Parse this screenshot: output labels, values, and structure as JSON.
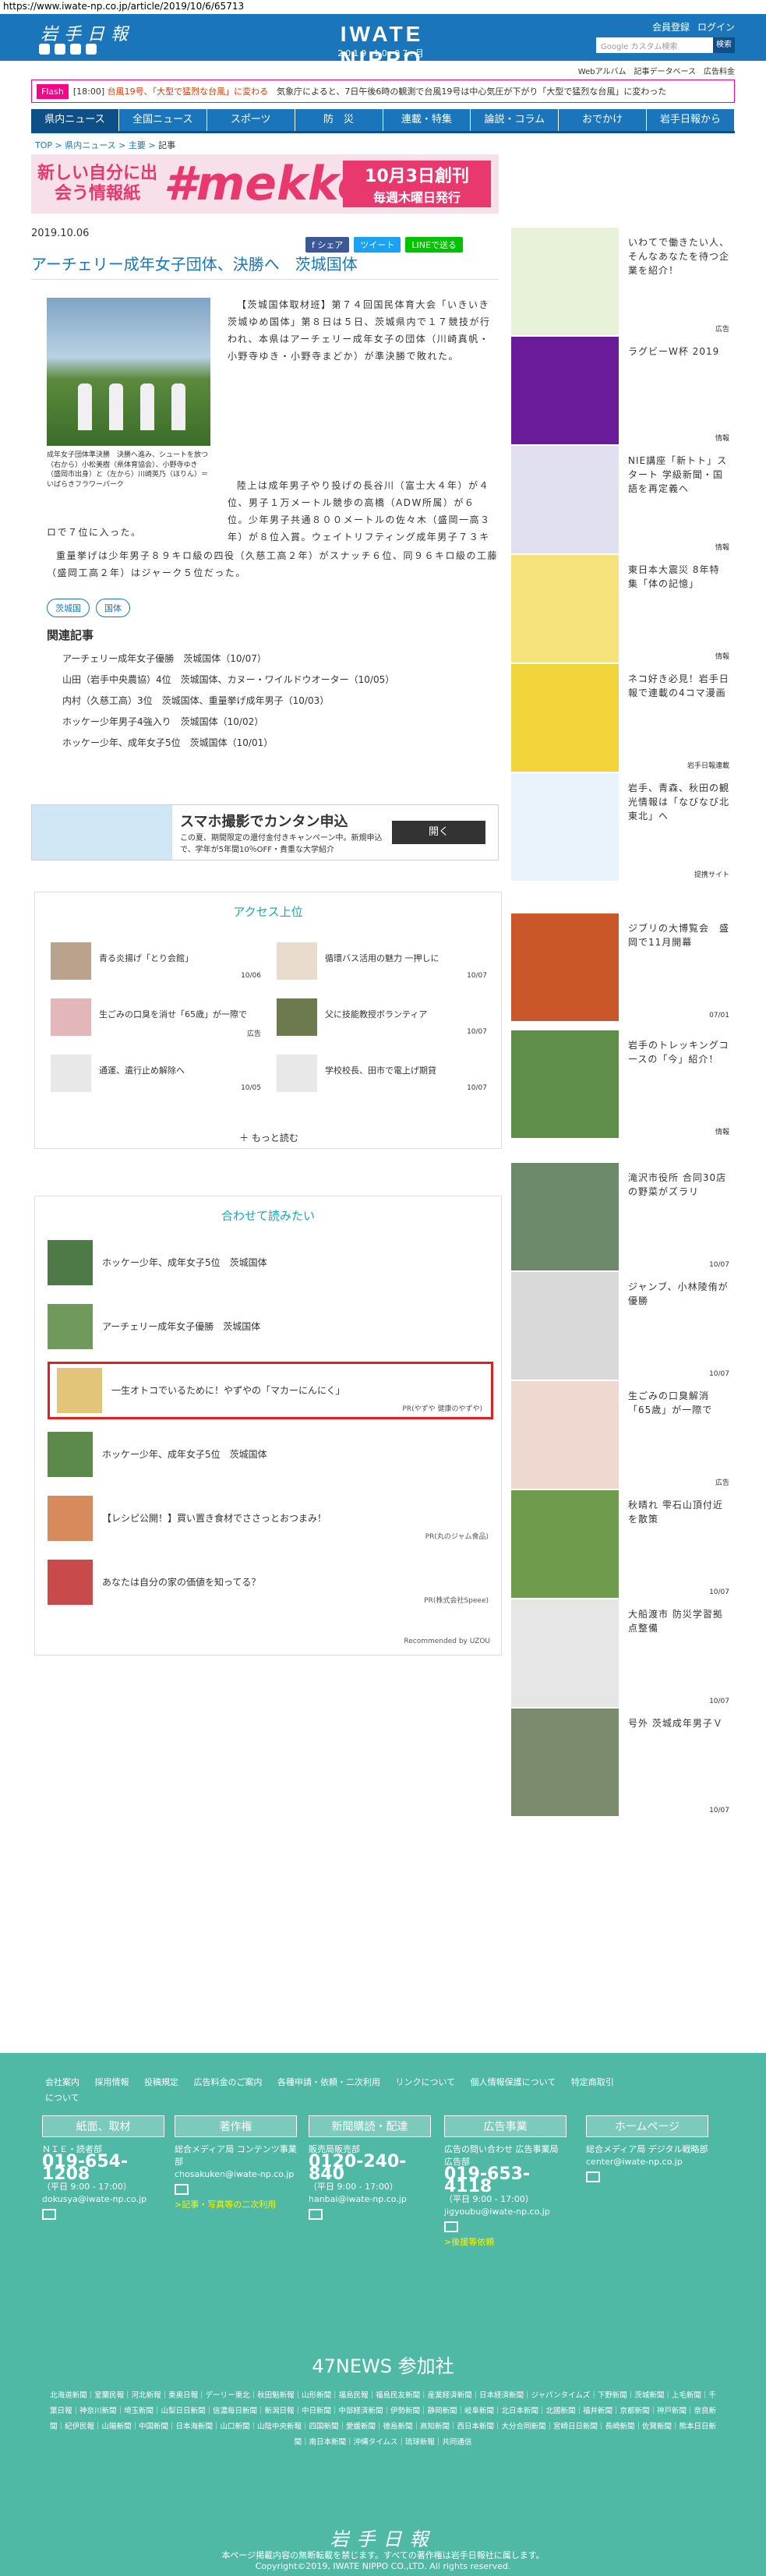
{
  "url": "https://www.iwate-np.co.jp/article/2019/10/6/65713",
  "header": {
    "logo_left": "岩手日報",
    "logo_center": "IWATE NIPPO",
    "date": "2019.10.07.月",
    "links": [
      "会員登録",
      "ログイン"
    ],
    "search_placeholder": "Google カスタム検索",
    "search_button": "検索",
    "sublinks": [
      "Webアルバム",
      "記事データベース",
      "広告料金"
    ]
  },
  "flash": {
    "tag": "Flash",
    "prefix": "[18:00]",
    "headline": "台風19号、「大型で猛烈な台風」に変わる",
    "rest": "気象庁によると、7日午後6時の観測で台風19号は中心気圧が下がり「大型で猛烈な台風」に変わった"
  },
  "nav": [
    "県内ニュース",
    "全国ニュース",
    "スポーツ",
    "防　災",
    "連載・特集",
    "論説・コラム",
    "おでかけ",
    "岩手日報から"
  ],
  "breadcrumb": [
    "TOP",
    "県内ニュース",
    "主要",
    "記事"
  ],
  "banner": {
    "left": "新しい自分に出会う情報紙",
    "center": "#mekke",
    "right_top": "10月3日創刊",
    "right_bottom": "毎週木曜日発行"
  },
  "article": {
    "date": "2019.10.06",
    "share": [
      "f シェア",
      "ツイート",
      "LINEで送る"
    ],
    "share_colors": [
      "#3b5998",
      "#1da1f2",
      "#00c300"
    ],
    "title": "アーチェリー成年女子団体、決勝へ　茨城国体",
    "caption": "成年女子団体準決勝　決勝へ進み、シュートを放つ（右から）小松美樹（県体育協会）、小野寺ゆき（盛岡市出身）と（左から）川崎英乃（ほりん）＝いばらきフラワーパーク",
    "p1": "【茨城国体取材班】第７４回国民体育大会「いきいき茨城ゆめ国体」第８日は５日、茨城県内で１７競技が行われ、本県はアーチェリー成年女子の団体（川崎真帆・小野寺ゆき・小野寺まどか）が準決勝で敗れた。",
    "p2": "陸上は成年男子やり投げの長谷川（富士大４年）が４位、男子１万メートル競歩の高橋（ADW所属）が６位。少年男子共通８００メートルの佐々木（盛岡一高３年）が８位入賞。ウェイトリフティング成年男子７３キ",
    "p3": "ロで７位に入った。",
    "p4": "重量挙げは少年男子８９キロ級の四役（久慈工高２年）がスナッチ６位、同９６キロ級の工藤（盛岡工高２年）はジャーク５位だった。",
    "tags": [
      "茨城国",
      "国体"
    ],
    "related_heading": "関連記事",
    "related": [
      "アーチェリー成年女子優勝　茨城国体（10/07）",
      "山田（岩手中央農協）4位　茨城国体、カヌー・ワイルドウオーター（10/05）",
      "内村（久慈工高）3位　茨城国体、重量挙げ成年男子（10/03）",
      "ホッケー少年男子4強入り　茨城国体（10/02）",
      "ホッケー少年、成年女子5位　茨城国体（10/01）"
    ]
  },
  "ad": {
    "title": "スマホ撮影でカンタン申込",
    "sub": "この夏、期間限定の還付金付きキャンペーン中。新規申込で、学年が5年間10％OFF・貴重な大学紹介",
    "button": "開く"
  },
  "access": {
    "heading": "アクセス上位",
    "items": [
      {
        "title": "青る炎揚げ「とり会館」",
        "date": "10/06"
      },
      {
        "title": "循環バス活用の魅力 一押しに",
        "date": "10/07"
      },
      {
        "title": "生ごみの口臭を消せ「65歳」が一際で",
        "date": "広告"
      },
      {
        "title": "父に技能教授ボランティア",
        "date": "10/07"
      },
      {
        "title": "通運、遺行止め解除へ",
        "date": "10/05"
      },
      {
        "title": "学校校長、田市で電上げ期貸",
        "date": "10/07"
      }
    ],
    "more": "もっと読む"
  },
  "together": {
    "heading": "合わせて読みたい",
    "items": [
      {
        "title": "ホッケー少年、成年女子5位　茨城国体",
        "pr": ""
      },
      {
        "title": "アーチェリー成年女子優勝　茨城国体",
        "pr": ""
      },
      {
        "title": "一生オトコでいるために！やずやの「マカーにんにく」",
        "pr": "PR(やずや 健康のやずや)"
      },
      {
        "title": "ホッケー少年、成年女子5位　茨城国体",
        "pr": ""
      },
      {
        "title": "【レシピ公開！】買い置き食材でささっとおつまみ！",
        "pr": "PR(丸のジャム食品)"
      },
      {
        "title": "あなたは自分の家の価値を知ってる？",
        "pr": "PR(株式会社Speee)"
      }
    ],
    "recommended": "Recommended by UZOU"
  },
  "sidebar": [
    {
      "title": "いわてで働きたい人、そんなあなたを待つ企業を紹介！",
      "label": "広告",
      "color": "#e8f2d8"
    },
    {
      "title": "ラグビーW杯 2019",
      "label": "情報",
      "color": "#6a1b9a"
    },
    {
      "title": "NIE講座「新トト」スタート 学級新聞・国語を再定義へ",
      "label": "情報",
      "color": "#e0e0f0"
    },
    {
      "title": "東日本大震災 8年特集「体の記憶」",
      "label": "情報",
      "color": "#f6e27a"
    },
    {
      "title": "ネコ好き必見！岩手日報で連載の4コマ漫画",
      "label": "岩手日報連載",
      "color": "#f2d43b"
    },
    {
      "title": "岩手、青森、秋田の観光情報は「なびなび北東北」へ",
      "label": "提携サイト",
      "color": "#e9f3fb"
    },
    {
      "title": "ジブリの大博覧会　盛岡で11月開幕",
      "label": "07/01",
      "color": "#c9572a"
    },
    {
      "title": "岩手のトレッキングコースの「今」紹介！",
      "label": "情報",
      "color": "#5f8e4a"
    },
    {
      "title": "滝沢市役所 合同30店の野菜がズラリ",
      "label": "10/07",
      "color": "#6d8a6a"
    },
    {
      "title": "ジャンブ、小林陵侑が優勝",
      "label": "10/07",
      "color": "#d9d9d9"
    },
    {
      "title": "生ごみの口臭解消「65歳」が一際で",
      "label": "広告",
      "color": "#eed8d0"
    },
    {
      "title": "秋晴れ 雫石山頂付近を散策",
      "label": "10/07",
      "color": "#6f9c4c"
    },
    {
      "title": "大船渡市 防災学習拠点整備",
      "label": "10/07",
      "color": "#e6e6e6"
    },
    {
      "title": "号外 茨城成年男子Ｖ",
      "label": "10/07",
      "color": "#7a8b6e"
    }
  ],
  "footer": {
    "links": [
      "会社案内",
      "採用情報",
      "投稿規定",
      "広告料金のご案内",
      "各種申請・依頼・二次利用",
      "リンクについて",
      "個人情報保護について",
      "特定商取引について"
    ],
    "cols": [
      {
        "head": "紙面、取材",
        "sub": "ＮＩＥ・読者部",
        "tel": "019-654-1208",
        "hours": "（平日 9:00 - 17:00）",
        "mail": "dokusya@iwate-np.co.jp",
        "extra": ""
      },
      {
        "head": "著作権",
        "sub": "総合メディア局 コンテンツ事業部",
        "tel": "",
        "hours": "",
        "mail": "chosakuken@iwate-np.co.jp",
        "extra": ">記事・写真等の二次利用"
      },
      {
        "head": "新聞購読・配達",
        "sub": "販売局販売部",
        "tel": "0120-240-840",
        "hours": "（平日 9:00 - 17:00）",
        "mail": "hanbai@iwate-np.co.jp",
        "extra": ""
      },
      {
        "head": "広告事業",
        "sub": "広告の問い合わせ 広告事業局広告部",
        "tel": "019-653-4118",
        "hours": "（平日 9:00 - 17:00）",
        "mail": "jigyoubu@iwate-np.co.jp",
        "extra": ">後援等依頼"
      },
      {
        "head": "ホームページ",
        "sub": "総合メディア局 デジタル戦略部",
        "tel": "",
        "hours": "",
        "mail": "center@iwate-np.co.jp",
        "extra": ""
      }
    ],
    "news47_heading": "47NEWS 参加社",
    "news47": "北海道新聞｜室蘭民報｜河北新報｜東奥日報｜デーリー東北｜秋田魁新報｜山形新聞｜福島民報｜福島民友新聞｜産業経済新聞｜日本経済新聞｜ジャパンタイムズ｜下野新聞｜茨城新聞｜上毛新聞｜千葉日報｜神奈川新聞｜埼玉新聞｜山梨日日新聞｜信濃毎日新聞｜新潟日報｜中日新聞｜中部経済新聞｜伊勢新聞｜静岡新聞｜岐阜新聞｜北日本新聞｜北國新聞｜福井新聞｜京都新聞｜神戸新聞｜奈良新聞｜紀伊民報｜山陽新聞｜中国新聞｜日本海新聞｜山口新聞｜山陰中央新報｜四国新聞｜愛媛新聞｜徳島新聞｜高知新聞｜西日本新聞｜大分合同新聞｜宮崎日日新聞｜長崎新聞｜佐賀新聞｜熊本日日新聞｜南日本新聞｜沖縄タイムス｜琉球新報｜共同通信",
    "logo": "岩手日報",
    "copy1": "本ページ掲載内容の無断転載を禁じます。すべての著作権は岩手日報社に属します。",
    "copy2": "Copyright©2019, IWATE NIPPO CO.,LTD. All rights reserved."
  }
}
